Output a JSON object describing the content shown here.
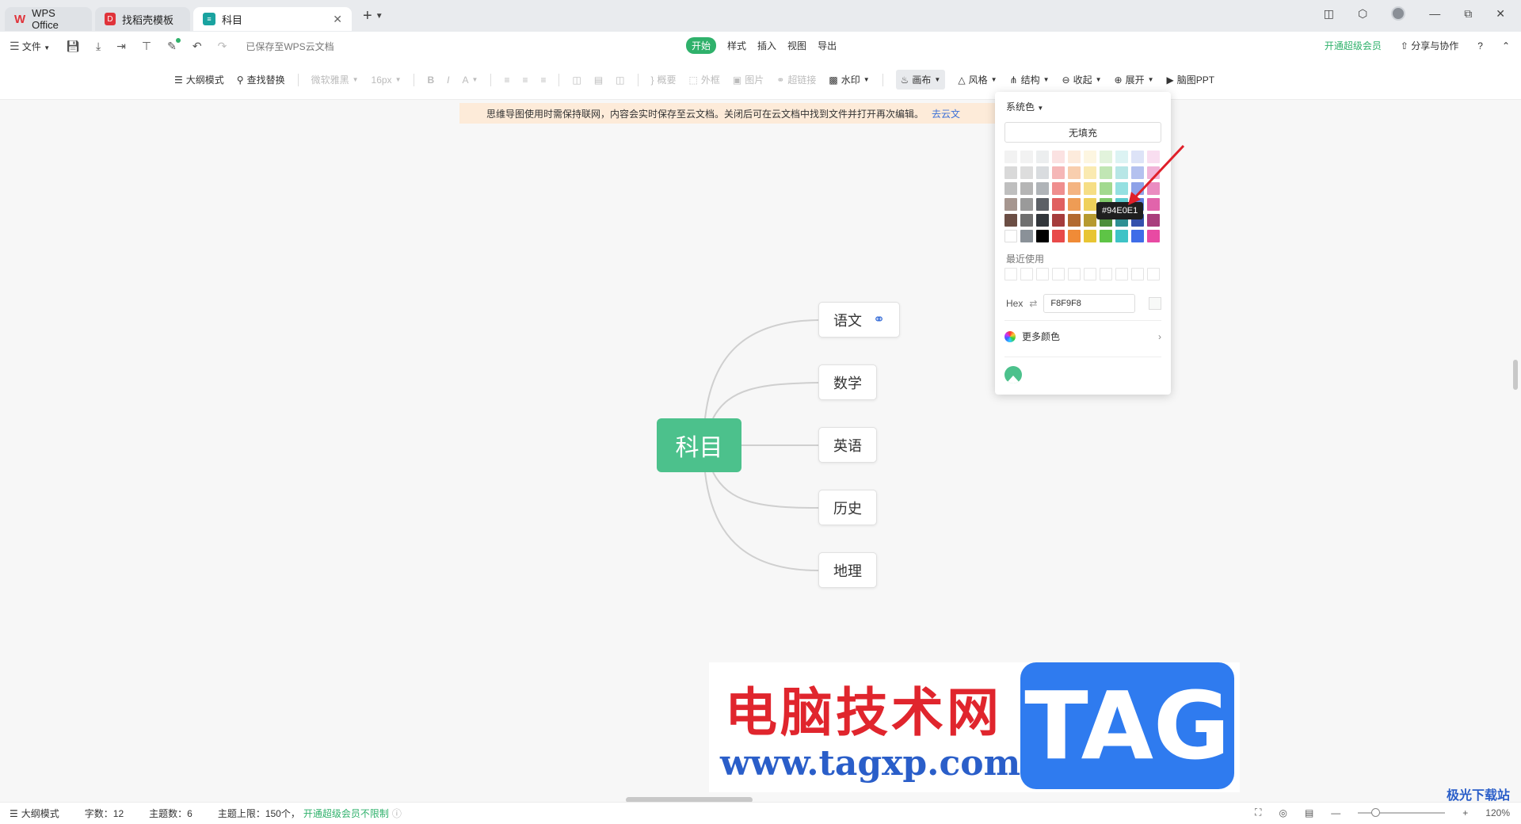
{
  "tabs": [
    {
      "label": "WPS Office",
      "icon": "wps-logo-icon"
    },
    {
      "label": "找稻壳模板",
      "icon": "docer-icon"
    },
    {
      "label": "科目",
      "icon": "mindmap-file-icon",
      "active": true
    }
  ],
  "menubar": {
    "file_label": "文件",
    "saved_status": "已保存至WPS云文档",
    "menu_items": [
      "开始",
      "样式",
      "插入",
      "视图",
      "导出"
    ],
    "active_menu": "开始",
    "vip_label": "开通超级会员",
    "share_label": "分享与协作"
  },
  "toolbar": {
    "outline_label": "大纲模式",
    "find_label": "查找替换",
    "font_name": "微软雅黑",
    "font_size": "16px",
    "summary_label": "概要",
    "frame_label": "外框",
    "image_label": "图片",
    "hyperlink_label": "超链接",
    "watermark_label": "水印",
    "canvas_label": "画布",
    "style_label": "风格",
    "structure_label": "结构",
    "collapse_label": "收起",
    "expand_label": "展开",
    "ppt_label": "脑图PPT"
  },
  "notice": {
    "text": "思维导图使用时需保持联网，内容会实时保存至云文档。关闭后可在云文档中找到文件并打开再次编辑。",
    "link": "去云文"
  },
  "mindmap": {
    "root": "科目",
    "children": [
      "语文",
      "数学",
      "英语",
      "历史",
      "地理"
    ],
    "linked_child": "语文",
    "root_color": "#4cc18c"
  },
  "color_picker": {
    "palette_label": "系统色",
    "no_fill_label": "无填充",
    "recent_label": "最近使用",
    "hex_label": "Hex",
    "hex_value": "F8F9F8",
    "more_colors_label": "更多颜色",
    "tooltip": "#94E0E1",
    "palette": [
      [
        "#f2f2f2",
        "#f2f2f2",
        "#eceeef",
        "#fbe2e2",
        "#fdebdc",
        "#fdf6e1",
        "#e2f3dc",
        "#dcf3f3",
        "#dde3f7",
        "#f9def0"
      ],
      [
        "#d9d9d9",
        "#dddddd",
        "#d9dcdf",
        "#f5b7b7",
        "#f8ceae",
        "#faeab1",
        "#c1e6b4",
        "#b7e6e6",
        "#b4c1ef",
        "#f1b4d8"
      ],
      [
        "#bfbfbf",
        "#b5b5b5",
        "#b0b4b8",
        "#ef8e8e",
        "#f4b482",
        "#f6de85",
        "#a2d98f",
        "#94e0e1",
        "#8ea2e8",
        "#ea8cc1"
      ],
      [
        "#a6968f",
        "#9a9a9a",
        "#5c6066",
        "#e06060",
        "#ee9c55",
        "#efd05a",
        "#80c96b",
        "#5ccbce",
        "#5e7de0",
        "#e164ab"
      ],
      [
        "#6b4e44",
        "#707070",
        "#32363b",
        "#a53c3c",
        "#b26a30",
        "#b79a2f",
        "#4c8f3a",
        "#2d9093",
        "#3551ad",
        "#a93d7d"
      ],
      [
        "#ffffff",
        "#8a9198",
        "#000000",
        "#e84a4a",
        "#f08b37",
        "#e8c533",
        "#5ec446",
        "#3ec3c6",
        "#3f6de8",
        "#e84aa3"
      ]
    ]
  },
  "watermark": {
    "cn": "电脑技术网",
    "url": "www.tagxp.com",
    "tag": "TAG"
  },
  "statusbar": {
    "outline_label": "大纲模式",
    "word_count_label": "字数：12",
    "topic_count_label": "主题数：6",
    "topic_limit_label": "主题上限：150个，",
    "vip_unlimited": "开通超级会员不限制",
    "zoom": "120%",
    "zoom_fraction": 0.2
  },
  "brand_mark": "极光下载站"
}
